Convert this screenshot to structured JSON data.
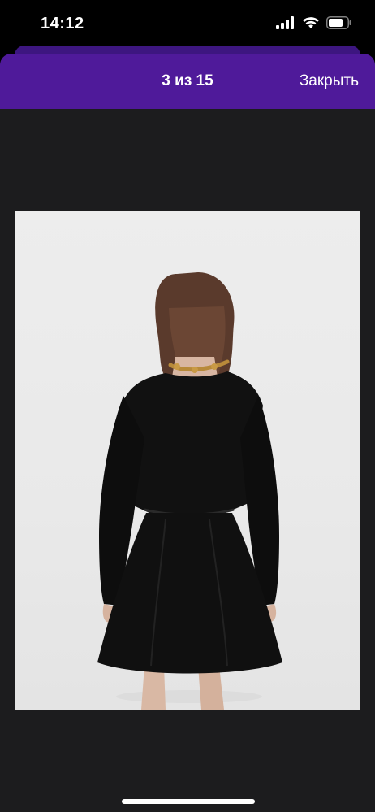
{
  "status_bar": {
    "time": "14:12",
    "icons": [
      "cellular-signal-icon",
      "wifi-icon",
      "battery-icon"
    ]
  },
  "header": {
    "counter": "3 из 15",
    "close_label": "Закрыть"
  },
  "gallery": {
    "image_subject": "woman-in-black-dress-back-view"
  },
  "colors": {
    "header_bg": "#4f1a9a",
    "sheet_bg": "#1c1c1e",
    "image_bg": "#ececec"
  }
}
